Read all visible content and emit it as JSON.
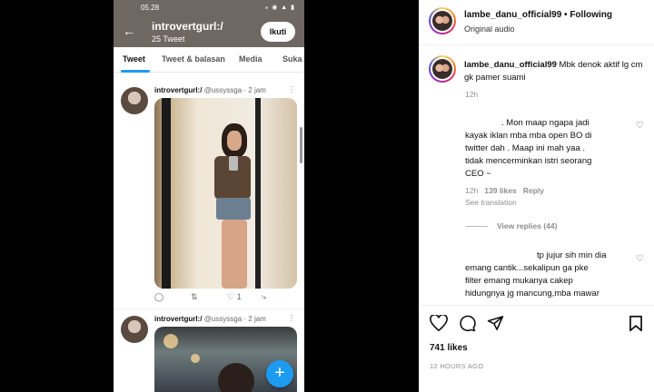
{
  "phone": {
    "status_time": "05.28",
    "status_icons": "⁎ ◉ ▲ ▮",
    "profile_name": "introvertgurl:/",
    "tweet_count": "25 Tweet",
    "follow_label": "Ikuti",
    "tabs": [
      "Tweet",
      "Tweet & balasan",
      "Media",
      "Suka"
    ],
    "tweets": [
      {
        "display_name": "introvertgurl:/",
        "handle": "@ussyssga",
        "time": "· 2 jam",
        "retweets": "",
        "likes": "1"
      },
      {
        "display_name": "introvertgurl:/",
        "handle": "@ussyssga",
        "time": "· 2 jam"
      }
    ],
    "fab_label": "+"
  },
  "post": {
    "username": "lambe_danu_official99",
    "follow_state": "Following",
    "sub_label": "Original audio",
    "caption": "Mbk denok aktif lg cm gk pamer suami",
    "caption_time": "12h",
    "comments": [
      {
        "text_lines": [
          ". Mon maap ngapa jadi",
          "kayak iklan mba mba open BO di",
          "twitter dah . Maap ini mah yaa .",
          "tidak mencerminkan istri seorang",
          "CEO ~"
        ],
        "time": "12h",
        "likes": "139 likes",
        "reply_label": "Reply",
        "see_translation": "See translation",
        "view_replies": "View replies (44)"
      },
      {
        "text_lines": [
          "tp jujur sih min dia",
          "emang cantik...sekalipun ga pke",
          "filter emang mukanya cakep",
          "hidungnya jg mancung,mba mawar"
        ]
      }
    ],
    "likes_count": "741 likes",
    "posted_ago": "12 HOURS AGO"
  },
  "colors": {
    "twitter_blue": "#1d9bf0",
    "header_bg": "#6f6762",
    "muted_text": "#8e8e8e"
  },
  "icons": [
    "back-arrow-icon",
    "more-icon",
    "reply-icon",
    "retweet-icon",
    "like-icon",
    "share-icon",
    "heart-icon",
    "comment-icon",
    "send-icon",
    "bookmark-icon"
  ]
}
